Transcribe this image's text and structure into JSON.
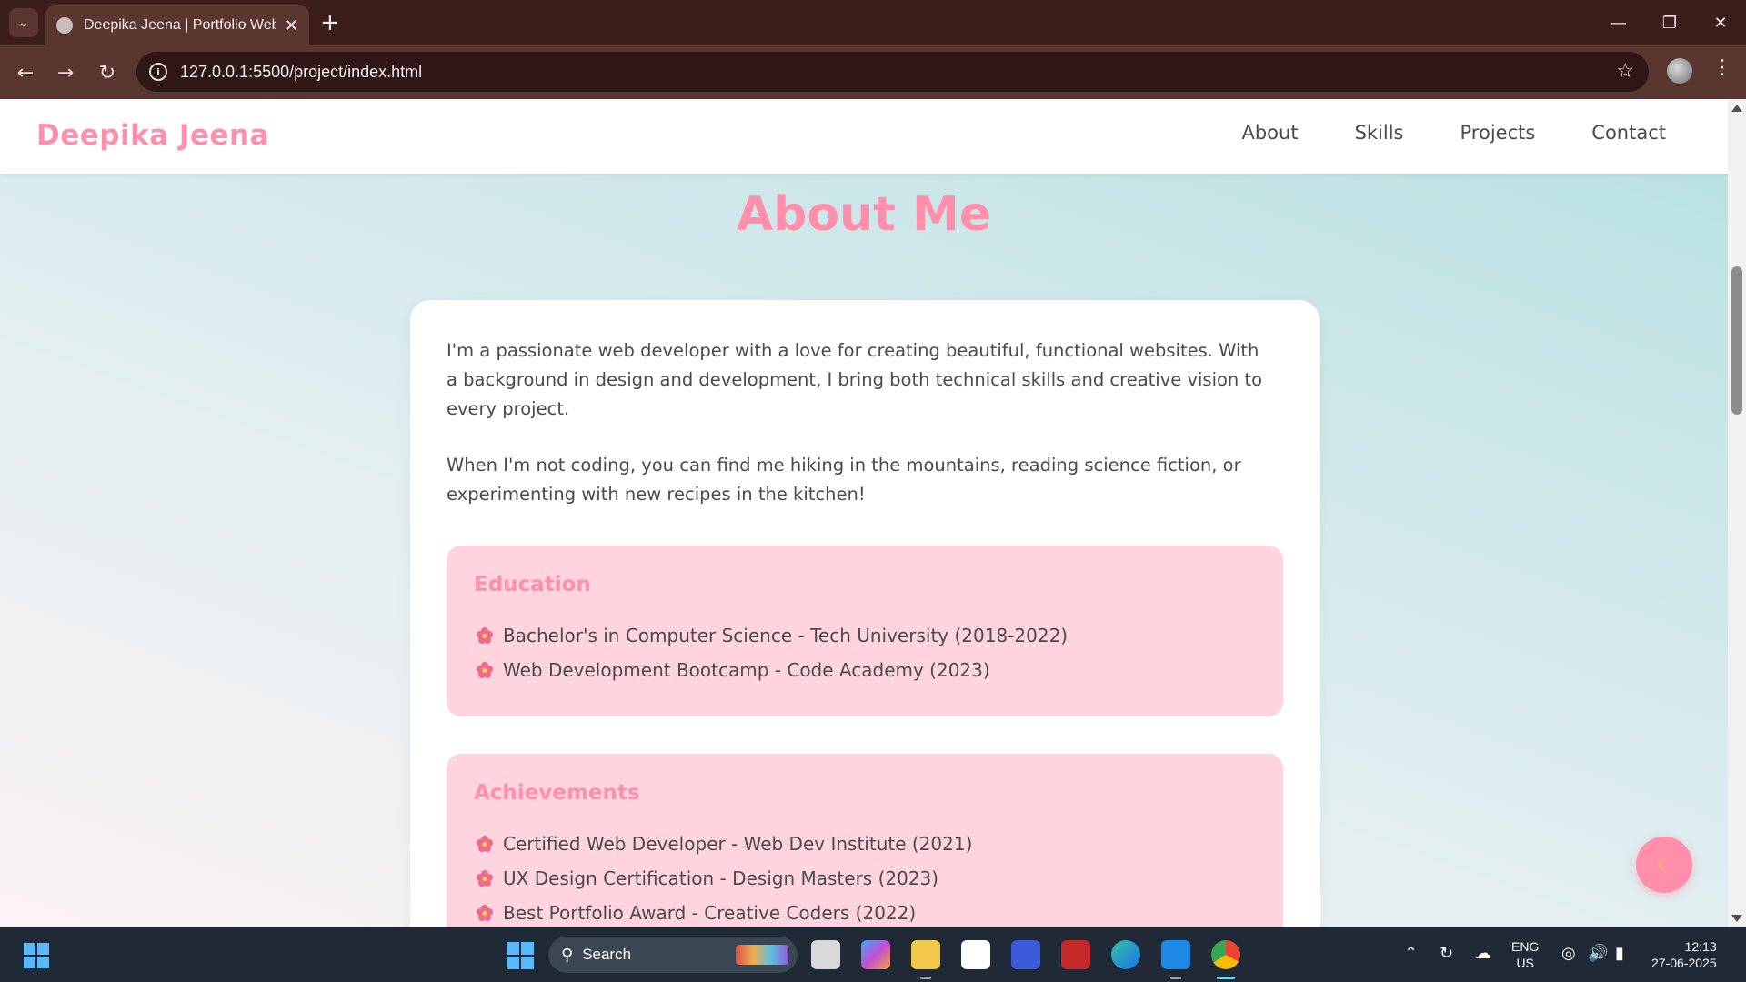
{
  "browser": {
    "tab_title": "Deepika Jeena | Portfolio Websi",
    "url": "127.0.0.1:5500/project/index.html"
  },
  "site": {
    "logo": "Deepika Jeena",
    "nav": [
      "About",
      "Skills",
      "Projects",
      "Contact"
    ]
  },
  "about": {
    "title": "About Me",
    "paragraphs": [
      "I'm a passionate web developer with a love for creating beautiful, functional websites. With a background in design and development, I bring both technical skills and creative vision to every project.",
      "When I'm not coding, you can find me hiking in the mountains, reading science fiction, or experimenting with new recipes in the kitchen!"
    ],
    "education": {
      "heading": "Education",
      "items": [
        "Bachelor's in Computer Science - Tech University (2018-2022)",
        "Web Development Bootcamp - Code Academy (2023)"
      ]
    },
    "achievements": {
      "heading": "Achievements",
      "items": [
        "Certified Web Developer - Web Dev Institute (2021)",
        "UX Design Certification - Design Masters (2023)",
        "Best Portfolio Award - Creative Coders (2022)"
      ]
    }
  },
  "theme_toggle": {
    "icon": "moon-icon"
  },
  "taskbar": {
    "search_label": "Search",
    "lang_line1": "ENG",
    "lang_line2": "US",
    "time": "12:13",
    "date": "27-06-2025"
  },
  "colors": {
    "accent_pink": "#ff8fab",
    "box_pink": "#ffd4df",
    "browser_dark": "#3b1d19",
    "browser_toolbar": "#5a3630"
  }
}
